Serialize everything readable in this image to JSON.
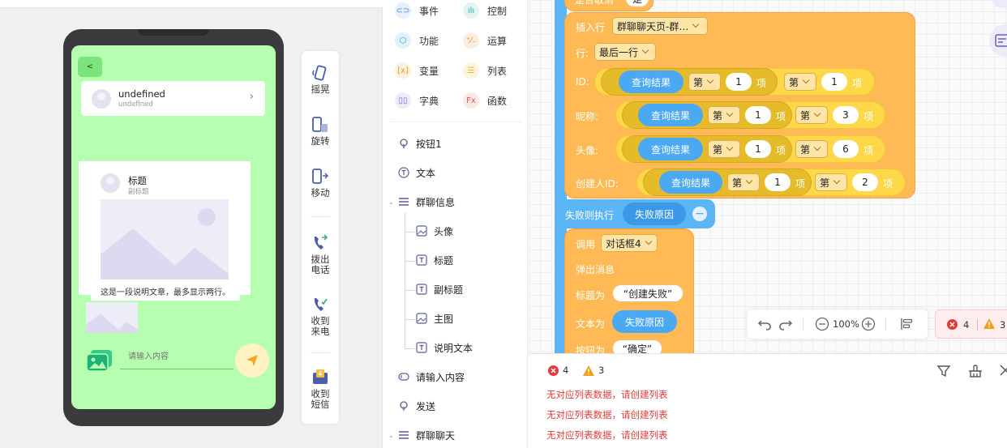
{
  "preview": {
    "back_label": "<",
    "user_card": {
      "name": "undefined",
      "sub": "undefined",
      "arrow": "›"
    },
    "list_card": {
      "title": "标题",
      "subtitle": "副标题",
      "description": "这是一段说明文章，最多显示两行。"
    },
    "input_placeholder": "请输入内容"
  },
  "actions": [
    {
      "label": "摇晃",
      "icon": "shake-icon"
    },
    {
      "label": "旋转",
      "icon": "rotate-icon"
    },
    {
      "label": "移动",
      "icon": "move-icon"
    },
    {
      "label": "拨出电话",
      "icon": "phone-out-icon"
    },
    {
      "label": "收到来电",
      "icon": "phone-in-icon"
    },
    {
      "label": "收到短信",
      "icon": "sms-icon"
    }
  ],
  "categories": [
    {
      "label": "事件",
      "color": "#4a8bd6"
    },
    {
      "label": "控制",
      "color": "#2ba6a6"
    },
    {
      "label": "功能",
      "color": "#21a8c8"
    },
    {
      "label": "运算",
      "color": "#e88a2a"
    },
    {
      "label": "变量",
      "color": "#e8a02a"
    },
    {
      "label": "列表",
      "color": "#e8b62a"
    },
    {
      "label": "字典",
      "color": "#7a6ad0"
    },
    {
      "label": "函数",
      "color": "#e05a4a"
    }
  ],
  "tree": {
    "button1": "按钮1",
    "text": "文本",
    "group_info": "群聊信息",
    "avatar": "头像",
    "title": "标题",
    "subtitle": "副标题",
    "main_image": "主图",
    "desc_text": "说明文本",
    "input": "请输入内容",
    "send": "发送",
    "group_chat": "群聊聊天"
  },
  "blocks": {
    "top_partial": "是否取消",
    "top_value": "是",
    "insert_row": "插入行",
    "insert_target": "群聊聊天页-群…",
    "row_label": "行:",
    "row_value": "最后一行",
    "query_result": "查询结果",
    "di": "第",
    "xiang": "项",
    "fields": [
      {
        "label": "ID:",
        "a": "1",
        "b": "1"
      },
      {
        "label": "昵称:",
        "a": "1",
        "b": "3"
      },
      {
        "label": "头像:",
        "a": "1",
        "b": "6"
      },
      {
        "label": "创建人ID:",
        "a": "1",
        "b": "2"
      }
    ],
    "fail_exec": "失败则执行",
    "fail_reason": "失败原因",
    "call": "调用",
    "dialog": "对话框4",
    "popup_msg": "弹出消息",
    "title_is": "标题为",
    "title_value": "“创建失败”",
    "text_is": "文本为",
    "button_is": "按钮为",
    "button_value": "“确定”"
  },
  "toolbar": {
    "zoom": "100%",
    "errors": "4",
    "warnings": "3"
  },
  "console": {
    "errors": "4",
    "warnings": "3",
    "messages": [
      "无对应列表数据，请创建列表",
      "无对应列表数据，请创建列表",
      "无对应列表数据，请创建列表"
    ]
  }
}
